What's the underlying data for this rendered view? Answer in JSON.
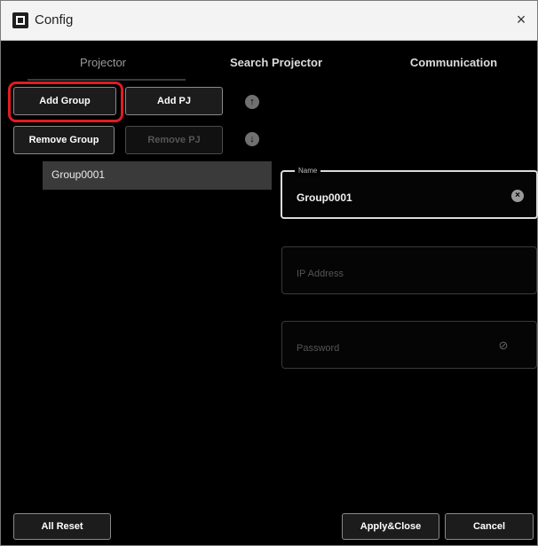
{
  "window": {
    "title": "Config",
    "close_symbol": "×",
    "icon": "config-app-icon"
  },
  "tabs": [
    {
      "label": "Projector",
      "active": true
    },
    {
      "label": "Search Projector",
      "active": false
    },
    {
      "label": "Communication",
      "active": false
    }
  ],
  "toolbar": {
    "add_group_label": "Add Group",
    "add_pj_label": "Add PJ",
    "remove_group_label": "Remove Group",
    "remove_pj_label": "Remove PJ",
    "move_up_icon": "arrow-up-icon",
    "move_down_icon": "arrow-down-icon"
  },
  "groups": [
    {
      "label": "Group0001",
      "selected": true
    }
  ],
  "form": {
    "name": {
      "legend": "Name",
      "value": "Group0001",
      "icon": "clear-icon"
    },
    "ip_address": {
      "placeholder": "IP Address",
      "value": ""
    },
    "password": {
      "placeholder": "Password",
      "value": "",
      "icon": "eye-slash-icon"
    }
  },
  "footer": {
    "all_reset_label": "All Reset",
    "apply_close_label": "Apply&Close",
    "cancel_label": "Cancel"
  },
  "colors": {
    "background": "#000000",
    "highlight": "#e01c22",
    "selected_row": "#3a3a3a"
  }
}
